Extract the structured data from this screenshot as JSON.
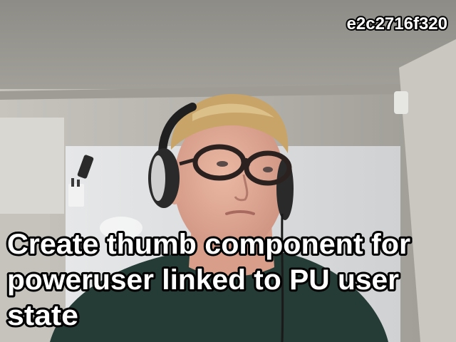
{
  "overlay": {
    "commit_hash": "e2c2716f320",
    "caption_lines": [
      "Create thumb component for",
      "poweruser linked to PU user",
      "state"
    ]
  },
  "scene": {
    "subject": "person wearing headphones and dark-rimmed glasses in an office room",
    "colors": {
      "ceiling": "#8f8e88",
      "wall": "#b9b7b1",
      "whiteboard": "#dedfe0",
      "skin": "#e2ac98",
      "hair": "#c9a66a",
      "shirt": "#243a34",
      "headphones": "#2a2a2a"
    }
  }
}
